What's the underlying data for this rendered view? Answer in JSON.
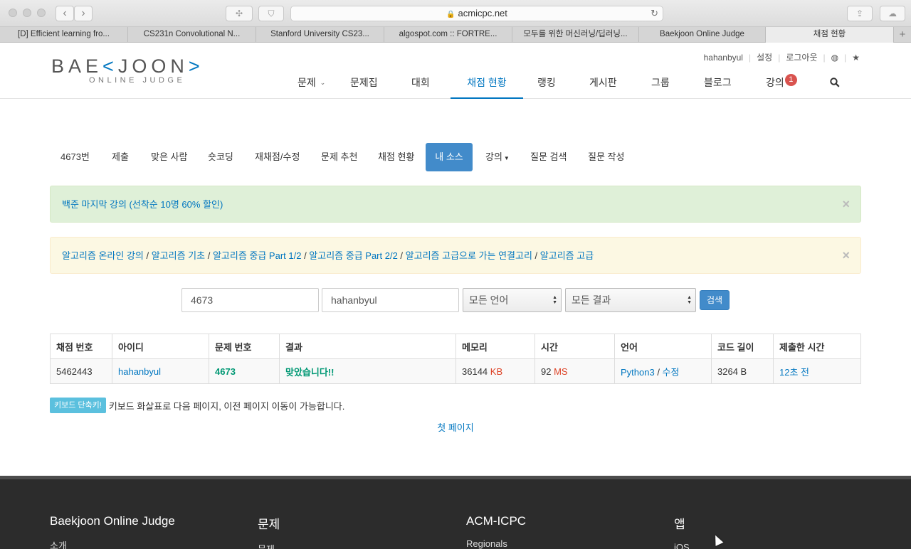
{
  "browser": {
    "url": "acmicpc.net",
    "tabs": [
      "[D] Efficient learning fro...",
      "CS231n Convolutional N...",
      "Stanford University CS23...",
      "algospot.com :: FORTRE...",
      "모두를 위한 머신러닝/딥러닝...",
      "Baekjoon Online Judge",
      "채점 현황"
    ],
    "active_tab_index": 6
  },
  "header": {
    "logo_text_left": "BAE",
    "logo_text_bracket_open": "<",
    "logo_text_right": "JOON",
    "logo_text_bracket_close": ">",
    "logo_sub": "ONLINE JUDGE",
    "user": "hahanbyul",
    "settings": "설정",
    "logout": "로그아웃",
    "nav": {
      "problems": "문제",
      "workbook": "문제집",
      "contest": "대회",
      "status": "채점 현황",
      "ranking": "랭킹",
      "board": "게시판",
      "group": "그룹",
      "blog": "블로그",
      "lecture": "강의",
      "lecture_badge": "1"
    }
  },
  "problem_tabs": {
    "number": "4673번",
    "submit": "제출",
    "solved_users": "맞은 사람",
    "short_coding": "숏코딩",
    "rejudge": "재채점/수정",
    "recommend": "문제 추천",
    "status": "채점 현황",
    "my_source": "내 소스",
    "lecture": "강의",
    "question_search": "질문 검색",
    "question_write": "질문 작성"
  },
  "alerts": {
    "success_text": "백준 마지막 강의 (선착순 10명 60% 할인)",
    "warning_links": [
      "알고리즘 온라인 강의",
      "알고리즘 기초",
      "알고리즘 중급 Part 1/2",
      "알고리즘 중급 Part 2/2",
      "알고리즘 고급으로 가는 연결고리",
      "알고리즘 고급"
    ],
    "separator": " / ",
    "close": "×"
  },
  "search": {
    "problem_id": "4673",
    "user_id": "hahanbyul",
    "language": "모든 언어",
    "result": "모든 결과",
    "button": "검색"
  },
  "table": {
    "headers": [
      "채점 번호",
      "아이디",
      "문제 번호",
      "결과",
      "메모리",
      "시간",
      "언어",
      "코드 길이",
      "제출한 시간"
    ],
    "row": {
      "submission_id": "5462443",
      "user": "hahanbyul",
      "problem": "4673",
      "result": "맞았습니다!!",
      "memory": "36144",
      "memory_unit": "KB",
      "time": "92",
      "time_unit": "MS",
      "language": "Python3",
      "lang_sep": " / ",
      "edit": "수정",
      "code_length": "3264 B",
      "submitted": "12초 전"
    }
  },
  "keyboard": {
    "label": "키보드 단축키!",
    "text": "키보드 화살표로 다음 페이지, 이전 페이지 이동이 가능합니다."
  },
  "pagination": {
    "first_page": "첫 페이지"
  },
  "footer": {
    "col1": {
      "title": "Baekjoon Online Judge",
      "item": "소개"
    },
    "col2": {
      "title": "문제",
      "item": "문제"
    },
    "col3": {
      "title": "ACM-ICPC",
      "item": "Regionals"
    },
    "col4": {
      "title": "앱",
      "item": "iOS"
    }
  },
  "colors": {
    "brand_blue": "#0076c0",
    "active_tab_blue": "#428bca",
    "accepted_green": "#009874",
    "unit_red": "#dd4124",
    "footer_bg": "#2c2c2c"
  }
}
